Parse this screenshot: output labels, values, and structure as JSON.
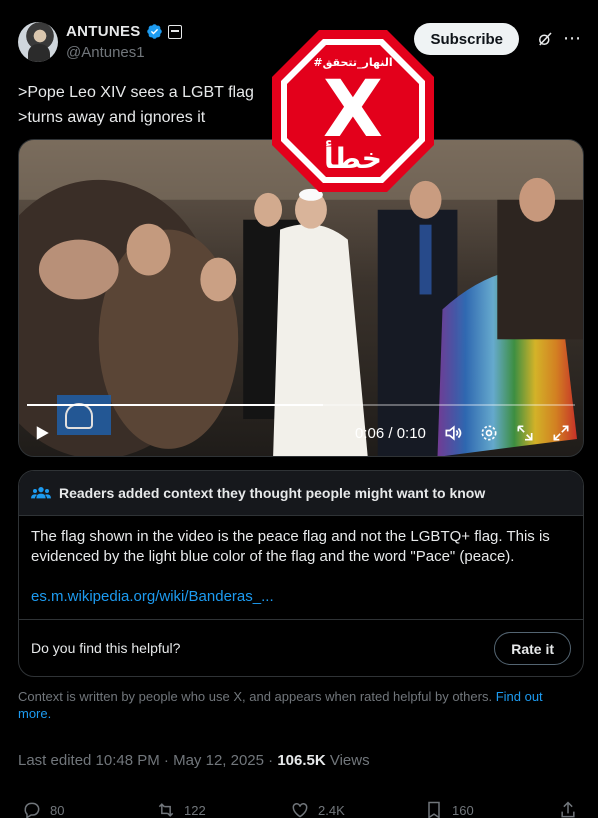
{
  "author": {
    "name": "ANTUNES",
    "handle": "@Antunes1"
  },
  "header": {
    "subscribe_label": "Subscribe"
  },
  "tweet": {
    "line1": ">Pope Leo XIV sees a LGBT flag",
    "line2": ">turns away and ignores it"
  },
  "video": {
    "time": "0:06 / 0:10",
    "progress": 0.54,
    "watermark": "VATICAN MEDIA"
  },
  "community_note": {
    "title": "Readers added context they thought people might want to know",
    "body": "The flag shown in the video is the peace flag and not the LGBTQ+ flag. This is evidenced by the light blue color of the flag and the word \"Pace\" (peace).",
    "link": "es.m.wikipedia.org/wiki/Banderas_...",
    "question": "Do you find this helpful?",
    "rate_label": "Rate it"
  },
  "disclaimer": {
    "text": "Context is written by people who use X, and appears when rated helpful by others. ",
    "link": "Find out more."
  },
  "meta": {
    "edited": "Last edited 10:48 PM · May 12, 2025 · ",
    "views_count": "106.5K",
    "views_label": " Views"
  },
  "actions": {
    "replies": "80",
    "reposts": "122",
    "likes": "2.4K",
    "bookmarks": "160"
  },
  "stamp": {
    "hashtag": "#النهار_تتحقق",
    "letter": "X",
    "verdict": "خطأ"
  },
  "colors": {
    "accent": "#1d9bf0",
    "verified": "#1d9bf0",
    "stamp_red": "#e3001b"
  }
}
